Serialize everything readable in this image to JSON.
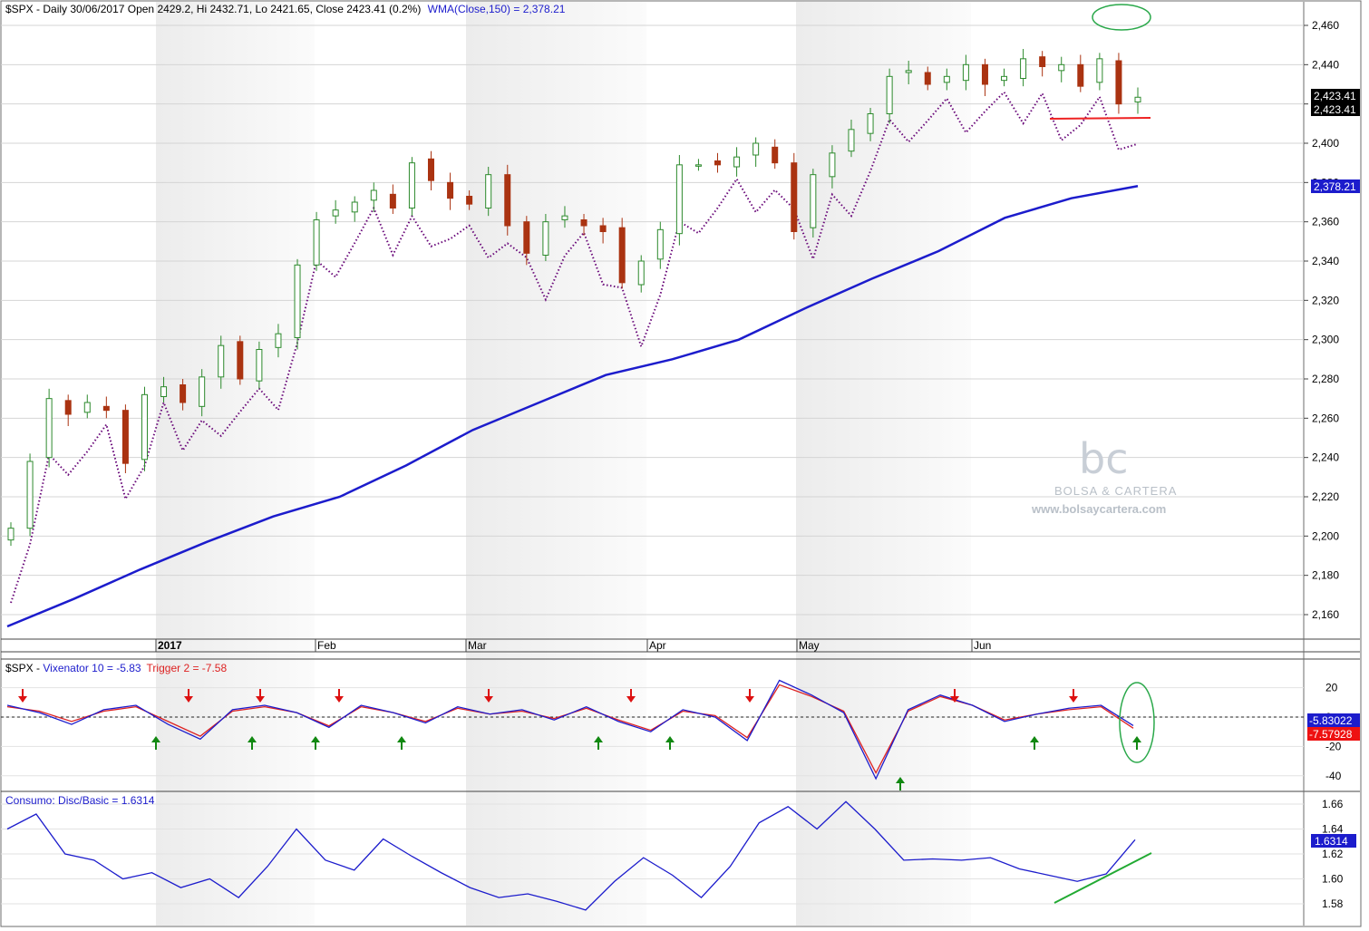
{
  "panels": {
    "price": {
      "symbol": "$SPX",
      "header_text": "$SPX - Daily 30/06/2017 Open 2429.2, Hi 2432.71, Lo 2421.65, Close 2423.41 (0.2%)",
      "wma_text": "WMA(Close,150) = 2,378.21",
      "last_close_label": "2,423.41",
      "wma_label": "2,378.21",
      "wma_color": "#1c1ccc",
      "candle_up_color": "#2c8a2c",
      "candle_down_color": "#aa3311",
      "dotted_color": "#6a0a7a",
      "support_color": "#ee2222",
      "highlight_color": "#2aa84a"
    },
    "vix": {
      "header_prefix": "$SPX - ",
      "vix_text": "Vixenator 10 = -5.83",
      "trigger_text": "Trigger 2 = -7.58",
      "vix_label": "-5.83022",
      "trigger_label": "-7.57928",
      "vix_color": "#1c1ccc",
      "trigger_color": "#dd2222"
    },
    "consumo": {
      "header_text": "Consumo: Disc/Basic = 1.6314",
      "value_label": "1.6314",
      "trend_color": "#22aa33"
    }
  },
  "watermark": {
    "logo_text": "bc",
    "brand": "BOLSA & CARTERA",
    "url": "www.bolsaycartera.com"
  },
  "x_axis": {
    "month_labels": [
      "2017",
      "Feb",
      "Mar",
      "Apr",
      "May",
      "Jun"
    ]
  },
  "chart_data": [
    {
      "type": "candlestick",
      "title": "$SPX - Daily 30/06/2017",
      "ylim": [
        2150,
        2465
      ],
      "yticks": [
        2160,
        2180,
        2200,
        2220,
        2240,
        2260,
        2280,
        2300,
        2320,
        2340,
        2360,
        2380,
        2400,
        2420,
        2440,
        2460
      ],
      "series": [
        {
          "name": "WMA(Close,150)",
          "type": "line",
          "values": [
            2154,
            2168,
            2183,
            2197,
            2210,
            2220,
            2236,
            2254,
            2268,
            2282,
            2290,
            2300,
            2316,
            2331,
            2345,
            2362,
            2372,
            2378.21
          ]
        },
        {
          "name": "$SPX close",
          "type": "candles",
          "values": [
            2204,
            2238,
            2270,
            2262,
            2268,
            2264,
            2237,
            2272,
            2276,
            2268,
            2281,
            2297,
            2280,
            2295,
            2303,
            2338,
            2361,
            2366,
            2370,
            2376,
            2367,
            2390,
            2381,
            2372,
            2369,
            2384,
            2358,
            2344,
            2360,
            2363,
            2358,
            2355,
            2329,
            2340,
            2356,
            2389,
            2389,
            2389,
            2393,
            2400,
            2390,
            2355,
            2384,
            2395,
            2407,
            2415,
            2434,
            2437,
            2430,
            2434,
            2440,
            2430,
            2434,
            2443,
            2439,
            2440,
            2429,
            2443,
            2420,
            2423.41
          ]
        }
      ]
    },
    {
      "type": "line",
      "title": "Vixenator 10",
      "ylim": [
        -45,
        30
      ],
      "yticks": [
        20,
        0,
        -20,
        -40
      ],
      "series": [
        {
          "name": "Vixenator 10",
          "values": [
            8,
            3,
            -5,
            5,
            8,
            -5,
            -15,
            5,
            8,
            3,
            -7,
            8,
            3,
            -4,
            7,
            2,
            5,
            -2,
            7,
            -3,
            -10,
            5,
            0,
            -16,
            25,
            15,
            3,
            -42,
            5,
            15,
            8,
            -3,
            2,
            6,
            8,
            -5.83
          ]
        },
        {
          "name": "Trigger 2",
          "values": [
            7,
            4,
            -3,
            4,
            7,
            -3,
            -13,
            4,
            7,
            3,
            -6,
            7,
            3,
            -3,
            6,
            2,
            4,
            -1,
            6,
            -2,
            -9,
            4,
            1,
            -14,
            22,
            14,
            4,
            -38,
            4,
            14,
            8,
            -2,
            2,
            5,
            7,
            -7.58
          ]
        }
      ]
    },
    {
      "type": "line",
      "title": "Consumo: Disc/Basic",
      "ylim": [
        1.57,
        1.67
      ],
      "yticks": [
        1.58,
        1.6,
        1.62,
        1.64,
        1.66
      ],
      "series": [
        {
          "name": "Consumo: Disc/Basic",
          "values": [
            1.64,
            1.652,
            1.62,
            1.615,
            1.6,
            1.605,
            1.593,
            1.6,
            1.585,
            1.61,
            1.64,
            1.615,
            1.607,
            1.632,
            1.618,
            1.605,
            1.593,
            1.585,
            1.588,
            1.582,
            1.575,
            1.598,
            1.617,
            1.603,
            1.585,
            1.61,
            1.645,
            1.658,
            1.64,
            1.662,
            1.64,
            1.615,
            1.616,
            1.615,
            1.617,
            1.608,
            1.603,
            1.598,
            1.604,
            1.6314
          ]
        }
      ]
    }
  ]
}
